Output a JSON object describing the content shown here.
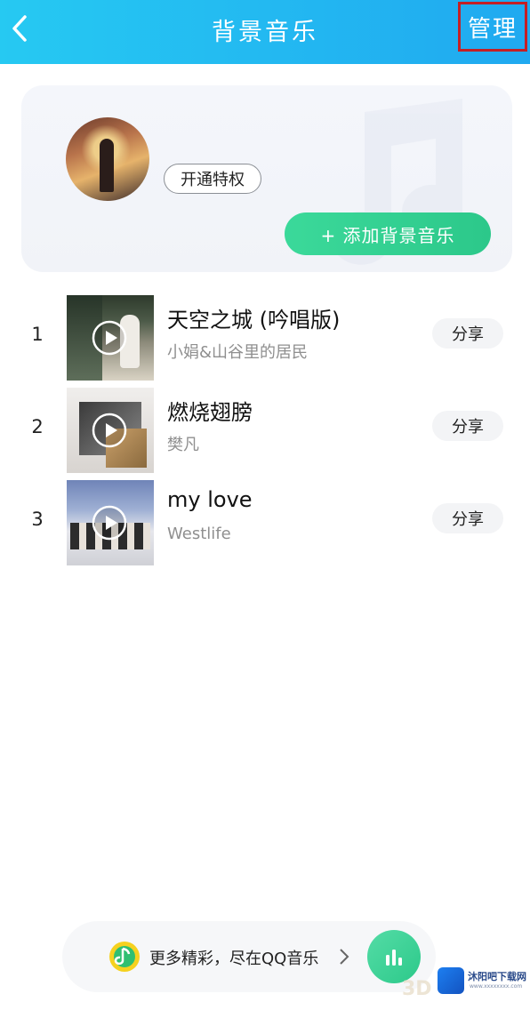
{
  "header": {
    "title": "背景音乐",
    "manage_label": "管理"
  },
  "card": {
    "vip_label": "开通特权",
    "add_music_label": "+ 添加背景音乐"
  },
  "songs": [
    {
      "index": "1",
      "title": "天空之城 (吟唱版)",
      "artist": "小娟&山谷里的居民",
      "share_label": "分享"
    },
    {
      "index": "2",
      "title": "燃烧翅膀",
      "artist": "樊凡",
      "share_label": "分享"
    },
    {
      "index": "3",
      "title": "my love",
      "artist": "Westlife",
      "share_label": "分享"
    }
  ],
  "promo": {
    "text": "更多精彩，尽在QQ音乐"
  },
  "watermark": {
    "name": "沐阳吧下载网",
    "url": "www.xxxxxxxx.com",
    "tag": "3D"
  },
  "colors": {
    "header_start": "#26c9f2",
    "header_end": "#20a9f0",
    "accent_green": "#2cc88a",
    "highlight_red": "#c41f24"
  },
  "icons": [
    "back-chevron-icon",
    "music-note-icon",
    "play-icon",
    "qq-music-logo-icon",
    "chevron-right-icon",
    "equalizer-icon"
  ]
}
